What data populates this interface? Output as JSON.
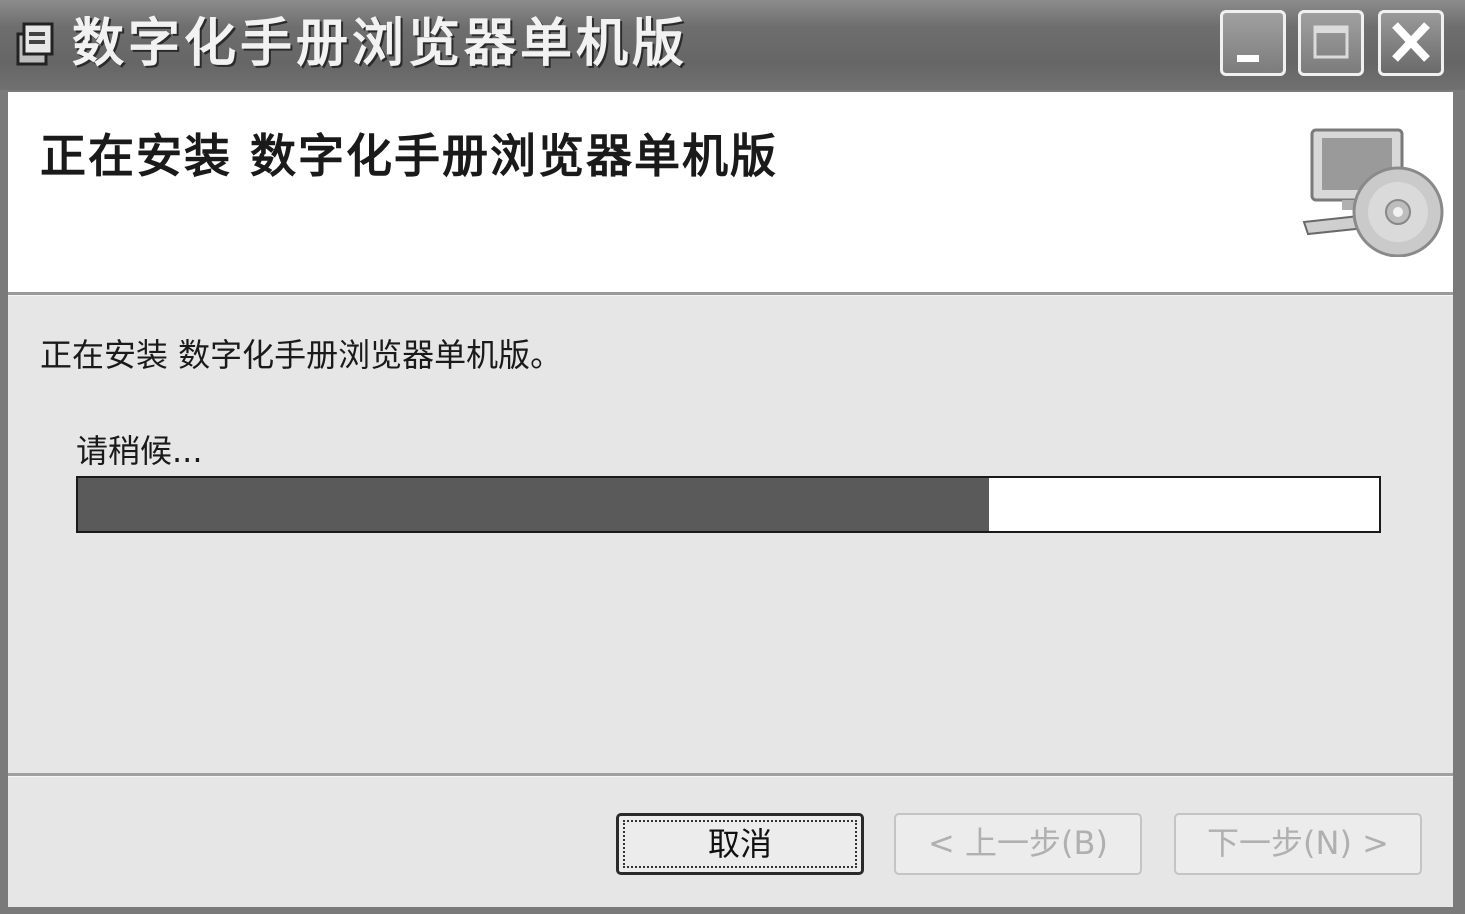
{
  "window": {
    "title": "数字化手册浏览器单机版"
  },
  "header": {
    "heading": "正在安装 数字化手册浏览器单机版"
  },
  "content": {
    "status": "正在安装 数字化手册浏览器单机版。",
    "wait_label": "请稍候...",
    "progress_fraction": 0.7
  },
  "buttons": {
    "cancel": "取消",
    "back": "< 上一步(B)",
    "next": "下一步(N) >",
    "back_enabled": false,
    "next_enabled": false
  },
  "icons": {
    "app": "installer-icon",
    "header": "computer-cd-icon"
  }
}
